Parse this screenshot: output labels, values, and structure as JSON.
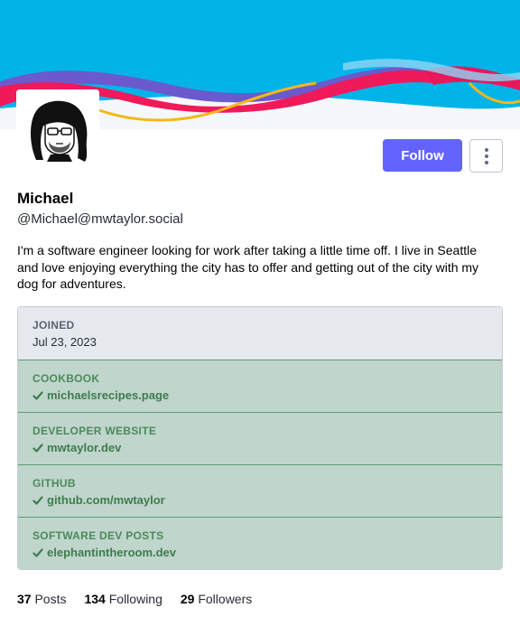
{
  "profile": {
    "display_name": "Michael",
    "handle": "@Michael@mwtaylor.social",
    "bio": "I'm a software engineer looking for work after taking a little time off. I live in Seattle and love enjoying everything the city has to offer and getting out of the city with my dog for adventures."
  },
  "actions": {
    "follow_label": "Follow",
    "more_icon": "more-vertical-icon"
  },
  "fields": [
    {
      "label": "JOINED",
      "value": "Jul 23, 2023",
      "verified": false
    },
    {
      "label": "COOKBOOK",
      "value": "michaelsrecipes.page",
      "verified": true
    },
    {
      "label": "DEVELOPER WEBSITE",
      "value": "mwtaylor.dev",
      "verified": true
    },
    {
      "label": "GITHUB",
      "value": "github.com/mwtaylor",
      "verified": true
    },
    {
      "label": "SOFTWARE DEV POSTS",
      "value": "elephantintheroom.dev",
      "verified": true
    }
  ],
  "stats": {
    "posts_count": "37",
    "posts_label": "Posts",
    "following_count": "134",
    "following_label": "Following",
    "followers_count": "29",
    "followers_label": "Followers"
  },
  "colors": {
    "accent": "#6364ff",
    "banner_sky": "#00b4ea",
    "verified_bg": "#c0d5cc",
    "verified_text": "#3d7c4f"
  }
}
